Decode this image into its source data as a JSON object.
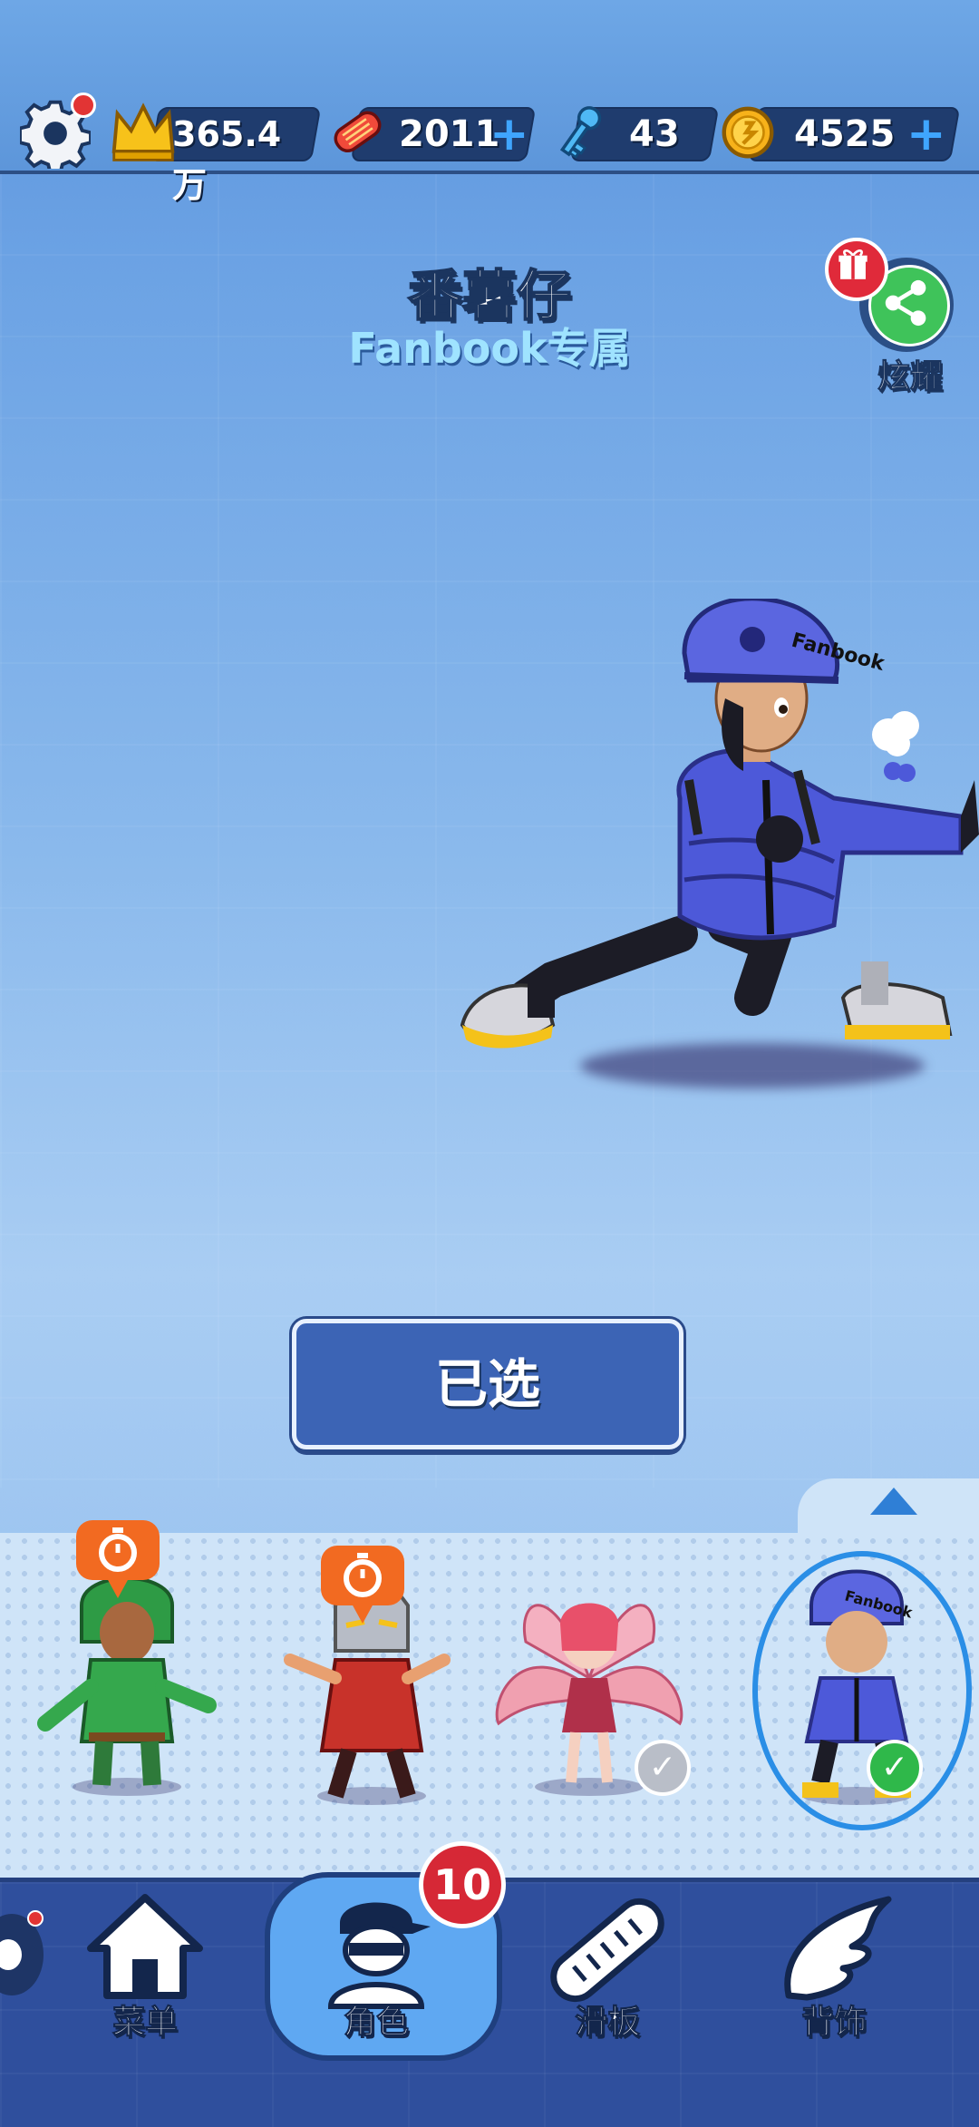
{
  "topbar": {
    "score": "365.4万",
    "boards": "2011",
    "keys": "43",
    "coins": "4525",
    "plus_label": "+"
  },
  "character": {
    "name": "番薯仔",
    "subtitle": "Fanbook专属",
    "helmet_text": "Fanbook"
  },
  "share": {
    "label": "炫耀"
  },
  "select_button": {
    "label": "已选"
  },
  "strip": {
    "thumbs": [
      {
        "name": "green-hood-character",
        "timer": true,
        "selected": false
      },
      {
        "name": "masked-character",
        "timer": true,
        "selected": false
      },
      {
        "name": "fox-girl-character",
        "timer": false,
        "owned": true
      },
      {
        "name": "fanbook-character",
        "timer": false,
        "selected": true
      }
    ],
    "thumb_helmet_text": "Fanbook"
  },
  "nav": {
    "items": [
      {
        "label": "菜单",
        "icon": "home-icon"
      },
      {
        "label": "角色",
        "icon": "character-icon",
        "active": true
      },
      {
        "label": "滑板",
        "icon": "skateboard-icon"
      },
      {
        "label": "背饰",
        "icon": "wings-icon"
      }
    ],
    "badge": "10"
  },
  "colors": {
    "accent": "#3c64b5",
    "nav": "#2f4f9d",
    "check": "#2fb84a"
  }
}
